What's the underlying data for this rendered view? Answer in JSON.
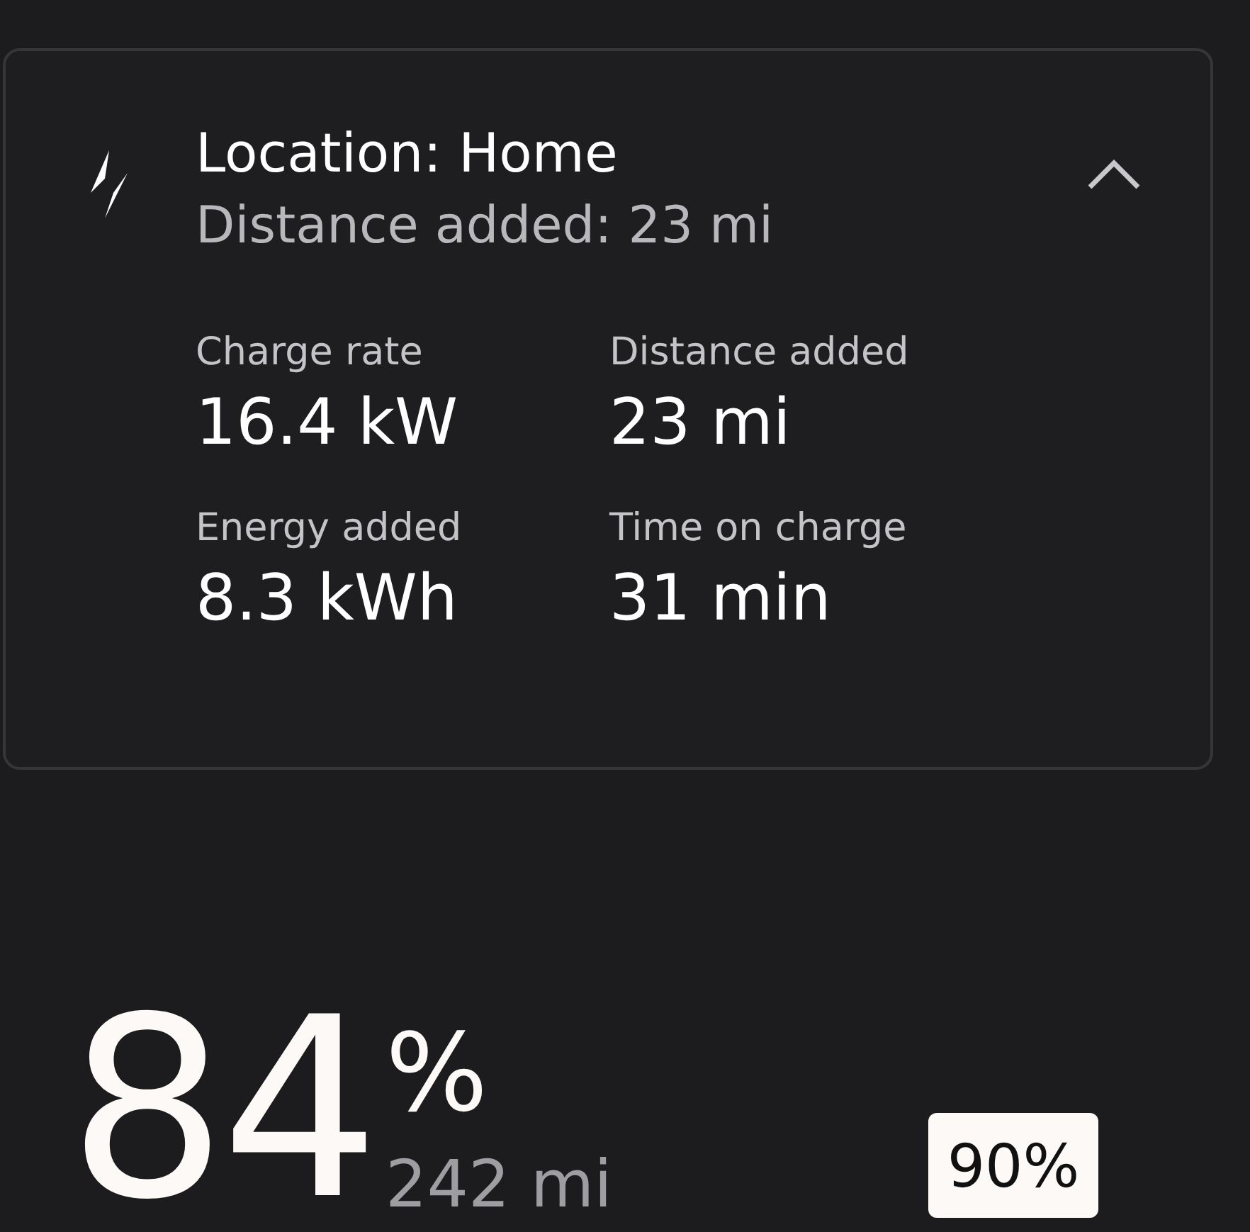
{
  "charging_card": {
    "title": "Location: Home",
    "subtitle": "Distance added: 23 mi",
    "expanded": true,
    "stats": [
      {
        "label": "Charge rate",
        "value": "16.4 kW"
      },
      {
        "label": "Distance added",
        "value": "23 mi"
      },
      {
        "label": "Energy added",
        "value": "8.3 kWh"
      },
      {
        "label": "Time on charge",
        "value": "31 min"
      }
    ]
  },
  "battery": {
    "percent": "84",
    "unit": "%",
    "range": "242 mi",
    "limit_badge": "90%"
  }
}
